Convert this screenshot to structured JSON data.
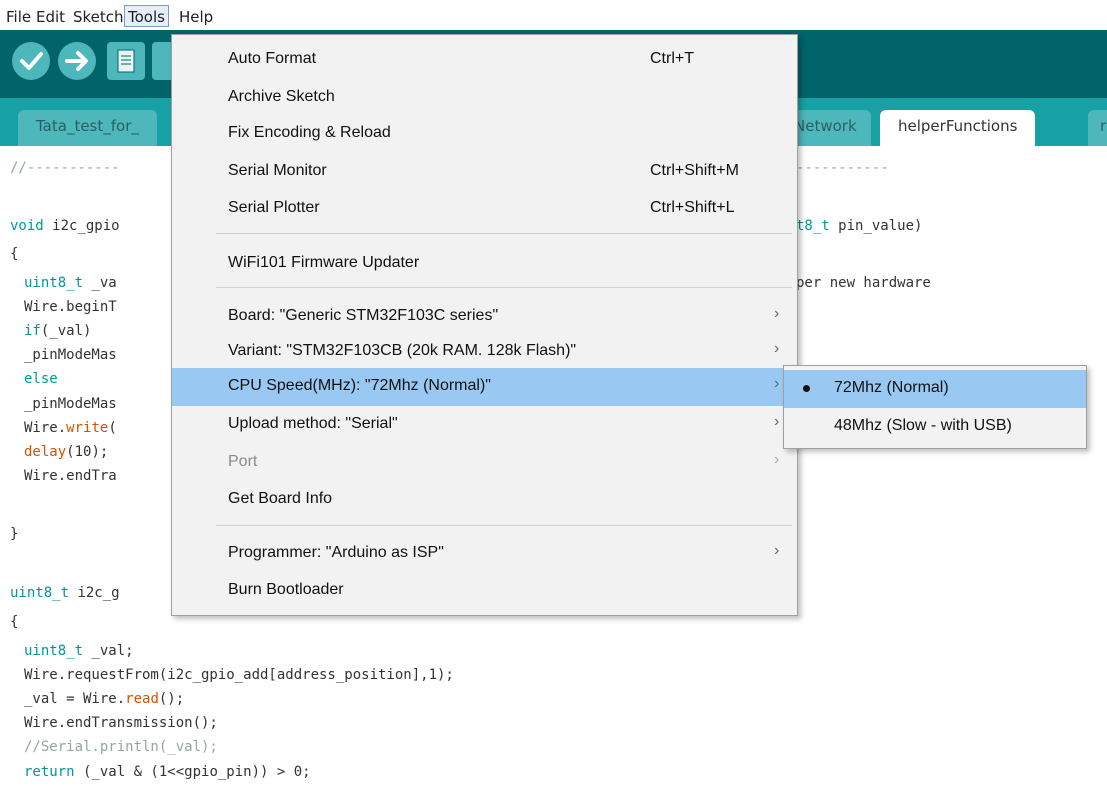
{
  "menubar": [
    "File",
    "Edit",
    "Sketch",
    "Tools",
    "Help"
  ],
  "tabs": [
    "Tata_test_for_",
    "Network",
    "helperFunctions",
    "r"
  ],
  "tools_menu": {
    "auto_format": {
      "label": "Auto Format",
      "shortcut": "Ctrl+T"
    },
    "archive_sketch": {
      "label": "Archive Sketch"
    },
    "fix_encoding": {
      "label": "Fix Encoding & Reload"
    },
    "serial_monitor": {
      "label": "Serial Monitor",
      "shortcut": "Ctrl+Shift+M"
    },
    "serial_plotter": {
      "label": "Serial Plotter",
      "shortcut": "Ctrl+Shift+L"
    },
    "wifi_updater": {
      "label": "WiFi101 Firmware Updater"
    },
    "board": {
      "label": "Board: \"Generic STM32F103C series\""
    },
    "variant": {
      "label": "Variant: \"STM32F103CB (20k RAM. 128k Flash)\""
    },
    "cpu_speed": {
      "label": "CPU Speed(MHz): \"72Mhz (Normal)\""
    },
    "upload_method": {
      "label": "Upload method: \"Serial\""
    },
    "port": {
      "label": "Port"
    },
    "board_info": {
      "label": "Get Board Info"
    },
    "programmer": {
      "label": "Programmer: \"Arduino as ISP\""
    },
    "burn_bootloader": {
      "label": "Burn Bootloader"
    }
  },
  "cpu_submenu": [
    "72Mhz (Normal)",
    "48Mhz (Slow - with USB)"
  ],
  "code": {
    "l1a": "//-----------",
    "l1b": "-----------",
    "l2a_kw": "void",
    "l2a": " i2c_gpio",
    "l2b_kw": "t8_t",
    "l2b": " pin_value)",
    "l3": "{",
    "l4a_kw": "uint8_t",
    "l4a": " _va",
    "l4b": "per new hardware",
    "l5": "Wire.beginT",
    "l6a_kw": "if",
    "l6a": "(_val)",
    "l7": "_pinModeMas",
    "l8_kw": "else",
    "l9": "_pinModeMas",
    "l10a": "Wire.",
    "l10b_fn": "write",
    "l10c": "(",
    "l11a_fn": "delay",
    "l11b": "(10);",
    "l12": "Wire.endTra",
    "l13": "}",
    "l14a_kw": "uint8_t",
    "l14b": " i2c_g",
    "l15": "{",
    "l16a_kw": "uint8_t",
    "l16b": " _val;",
    "l17": "Wire.requestFrom(i2c_gpio_add[address_position],1);",
    "l18a": "_val = Wire.",
    "l18b_fn": "read",
    "l18c": "();",
    "l19": "Wire.endTransmission();",
    "l20": "//Serial.println(_val);",
    "l21a_kw": "return",
    "l21b": " (_val & (1<<gpio_pin)) > 0;"
  }
}
